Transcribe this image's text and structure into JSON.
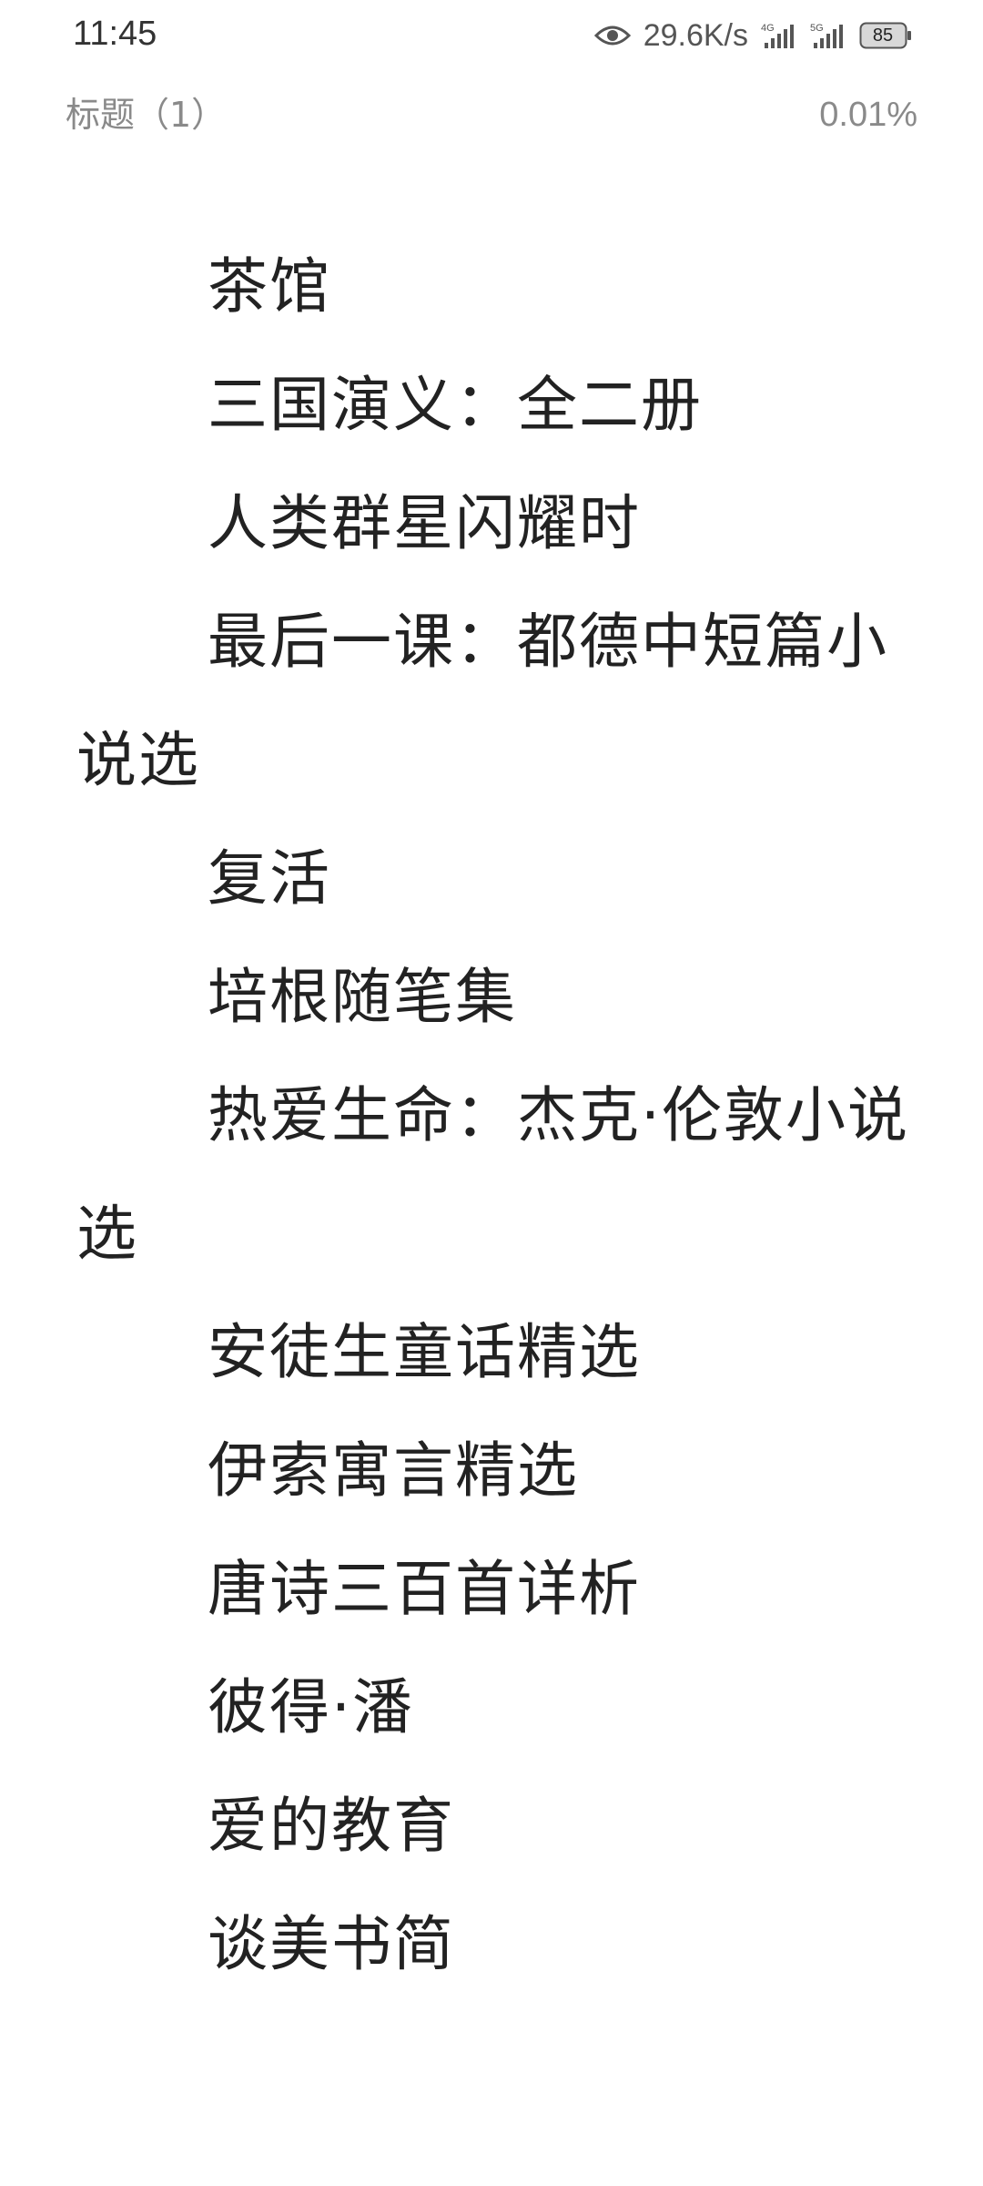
{
  "status_bar": {
    "time": "11:45",
    "net_speed": "29.6K/s",
    "battery_level": "85",
    "icons": [
      "eye-icon",
      "signal-4g-icon",
      "signal-5g-icon",
      "battery-icon"
    ]
  },
  "reader": {
    "chapter_title": "标题（1）",
    "progress": "0.01%"
  },
  "paragraphs": [
    "茶馆",
    "三国演义：全二册",
    "人类群星闪耀时",
    "最后一课：都德中短篇小说选",
    "复活",
    "培根随笔集",
    "热爱生命：杰克·伦敦小说选",
    "安徒生童话精选",
    "伊索寓言精选",
    "唐诗三百首详析",
    "彼得·潘",
    "爱的教育",
    "谈美书简"
  ]
}
